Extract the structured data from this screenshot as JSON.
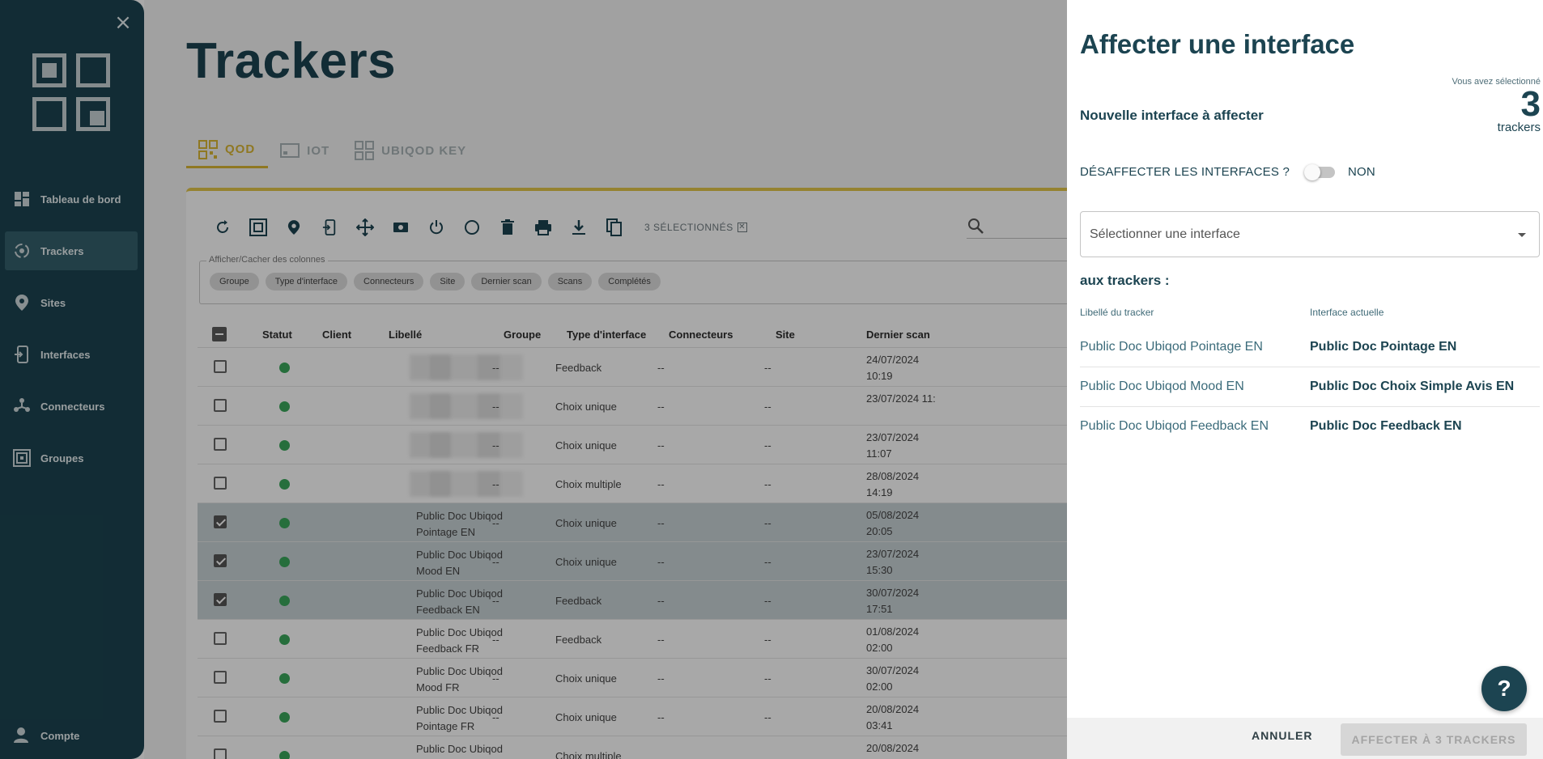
{
  "sidebar": {
    "items": [
      {
        "label": "Tableau de bord",
        "icon": "dashboard-icon"
      },
      {
        "label": "Trackers",
        "icon": "trackers-icon"
      },
      {
        "label": "Sites",
        "icon": "location-pin-icon"
      },
      {
        "label": "Interfaces",
        "icon": "interfaces-icon"
      },
      {
        "label": "Connecteurs",
        "icon": "connectors-icon"
      },
      {
        "label": "Groupes",
        "icon": "groups-icon"
      }
    ],
    "account_label": "Compte"
  },
  "main": {
    "title": "Trackers",
    "tabs": [
      {
        "label": "QOD"
      },
      {
        "label": "IOT"
      },
      {
        "label": "UBIQOD KEY"
      }
    ],
    "toolbar": {
      "selected_text": "3 SÉLECTIONNÉS",
      "clear_glyph": "✕"
    },
    "columns_filter": {
      "legend": "Afficher/Cacher des colonnes",
      "chips": [
        "Groupe",
        "Type d'interface",
        "Connecteurs",
        "Site",
        "Dernier scan",
        "Scans",
        "Complétés"
      ]
    },
    "table": {
      "headers": [
        "Statut",
        "Client",
        "Libellé",
        "Groupe",
        "Type d'interface",
        "Connecteurs",
        "Site",
        "Dernier scan"
      ],
      "rows": [
        {
          "label": "",
          "group": "--",
          "type": "Feedback",
          "conn": "--",
          "site": "--",
          "date": "24/07/2024",
          "time": "10:19",
          "checked": false,
          "blurred": true
        },
        {
          "label": "",
          "group": "--",
          "type": "Choix unique",
          "conn": "--",
          "site": "--",
          "date": "23/07/2024 11:",
          "time": "",
          "checked": false,
          "blurred": true
        },
        {
          "label": "",
          "group": "--",
          "type": "Choix unique",
          "conn": "--",
          "site": "--",
          "date": "23/07/2024",
          "time": "11:07",
          "checked": false,
          "blurred": true
        },
        {
          "label": "",
          "group": "--",
          "type": "Choix multiple",
          "conn": "--",
          "site": "--",
          "date": "28/08/2024",
          "time": "14:19",
          "checked": false,
          "blurred": true
        },
        {
          "label": "Public Doc Ubiqod Pointage EN",
          "group": "--",
          "type": "Choix unique",
          "conn": "--",
          "site": "--",
          "date": "05/08/2024",
          "time": "20:05",
          "checked": true,
          "blurred": false
        },
        {
          "label": "Public Doc Ubiqod Mood EN",
          "group": "--",
          "type": "Choix unique",
          "conn": "--",
          "site": "--",
          "date": "23/07/2024",
          "time": "15:30",
          "checked": true,
          "blurred": false
        },
        {
          "label": "Public Doc Ubiqod Feedback EN",
          "group": "--",
          "type": "Feedback",
          "conn": "--",
          "site": "--",
          "date": "30/07/2024",
          "time": "17:51",
          "checked": true,
          "blurred": false
        },
        {
          "label": "Public Doc Ubiqod Feedback FR",
          "group": "--",
          "type": "Feedback",
          "conn": "--",
          "site": "--",
          "date": "01/08/2024",
          "time": "02:00",
          "checked": false,
          "blurred": false
        },
        {
          "label": "Public Doc Ubiqod Mood FR",
          "group": "--",
          "type": "Choix unique",
          "conn": "--",
          "site": "--",
          "date": "30/07/2024",
          "time": "02:00",
          "checked": false,
          "blurred": false
        },
        {
          "label": "Public Doc Ubiqod Pointage FR",
          "group": "--",
          "type": "Choix unique",
          "conn": "--",
          "site": "--",
          "date": "20/08/2024",
          "time": "03:41",
          "checked": false,
          "blurred": false
        },
        {
          "label": "Public Doc Ubiqod",
          "group": "",
          "type": "Choix multiple",
          "conn": "",
          "site": "",
          "date": "20/08/2024",
          "time": "",
          "checked": false,
          "blurred": false
        }
      ]
    }
  },
  "panel": {
    "title": "Affecter une interface",
    "selection_caption": "Vous avez sélectionné",
    "selection_count": "3",
    "selection_unit": "trackers",
    "new_interface_label": "Nouvelle interface à affecter",
    "unassign_label": "DÉSAFFECTER LES INTERFACES ?",
    "unassign_value": "NON",
    "select_placeholder": "Sélectionner une interface",
    "to_trackers_label": "aux trackers :",
    "col_tracker": "Libellé du tracker",
    "col_current": "Interface actuelle",
    "assignments": [
      {
        "tracker": "Public Doc Ubiqod Pointage EN",
        "current": "Public Doc Pointage EN"
      },
      {
        "tracker": "Public Doc Ubiqod Mood EN",
        "current": "Public Doc Choix Simple Avis EN"
      },
      {
        "tracker": "Public Doc Ubiqod Feedback EN",
        "current": "Public Doc Feedback EN"
      }
    ],
    "help_label": "?",
    "cancel_label": "ANNULER",
    "assign_label": "AFFECTER À 3 TRACKERS"
  },
  "colors": {
    "sidebar_bg": "#1c4451",
    "accent_yellow": "#d9b634",
    "status_green": "#3aa75b",
    "title_dark": "#1c4451"
  }
}
